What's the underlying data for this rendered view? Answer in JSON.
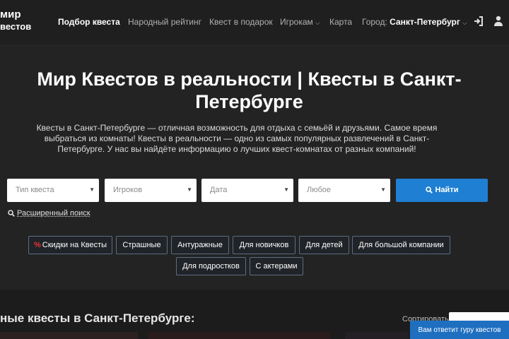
{
  "header": {
    "logo_line1": "мир",
    "logo_line2": "вестов",
    "nav": [
      {
        "label": "Подбор квеста"
      },
      {
        "label": "Народный рейтинг"
      },
      {
        "label": "Квест в подарок"
      },
      {
        "label": "Игрокам"
      },
      {
        "label": "Карта"
      }
    ],
    "city_label": "Город:",
    "city_value": "Санкт-Петербург"
  },
  "hero": {
    "title_line1": "Мир Квестов в реальности | Квесты в Санкт-",
    "title_line2": "Петербурге",
    "description": "Квесты в Санкт-Петербурге — отличная возможность для отдыха с семьёй и друзьями. Самое время выбраться из комнаты! Квесты в реальности — одно из самых популярных развлечений в Санкт-Петербурге. У нас вы найдёте информацию о лучших квест-комнатах от разных компаний!"
  },
  "filters": {
    "quest_type": "Тип квеста",
    "players": "Игроков",
    "date": "Дата",
    "time": "Любое",
    "search_button": "Найти",
    "advanced_search": "Расширенный поиск"
  },
  "tags": [
    {
      "label": "Скидки на Квесты",
      "prefix": "%"
    },
    {
      "label": "Страшные"
    },
    {
      "label": "Антуражные"
    },
    {
      "label": "Для новичков"
    },
    {
      "label": "Для детей"
    },
    {
      "label": "Для большой компании"
    },
    {
      "label": "Для подростков"
    },
    {
      "label": "С актерами"
    }
  ],
  "listing": {
    "section_title": "ные квесты в Санкт-Петербурге:",
    "sort_label": "Сортировать:"
  },
  "chat": {
    "label": "Вам ответит гуру квестов"
  }
}
